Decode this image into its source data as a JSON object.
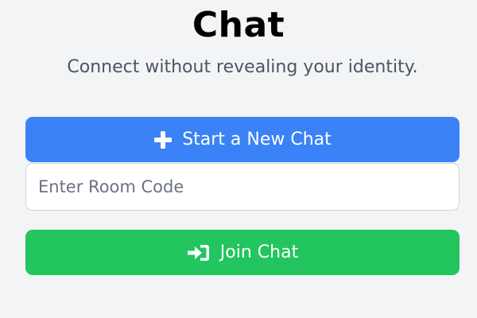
{
  "header": {
    "title": "Chat",
    "subtitle": "Connect without revealing your identity."
  },
  "actions": {
    "new_chat": {
      "label": "Start a New Chat",
      "icon": "plus-icon"
    },
    "room_code": {
      "value": "",
      "placeholder": "Enter Room Code"
    },
    "join_chat": {
      "label": "Join Chat",
      "icon": "sign-in-icon"
    }
  },
  "colors": {
    "accent": "#3b82f6",
    "success": "#22c55e",
    "background": "#f3f4f6"
  }
}
